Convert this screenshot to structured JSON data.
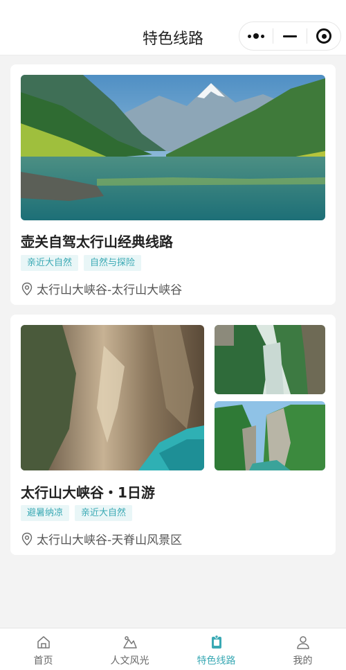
{
  "nav": {
    "title": "特色线路"
  },
  "routes": [
    {
      "title": "壶关自驾太行山经典线路",
      "tags": [
        "亲近大自然",
        "自然与探险"
      ],
      "location": "太行山大峡谷-太行山大峡谷"
    },
    {
      "title": "太行山大峡谷・1日游",
      "tags": [
        "避暑纳凉",
        "亲近大自然"
      ],
      "location": "太行山大峡谷-天脊山风景区"
    }
  ],
  "tabbar": {
    "items": [
      {
        "label": "首页",
        "icon": "home-icon"
      },
      {
        "label": "人文风光",
        "icon": "scenery-icon"
      },
      {
        "label": "特色线路",
        "icon": "route-icon"
      },
      {
        "label": "我的",
        "icon": "user-icon"
      }
    ],
    "active_index": 2
  },
  "colors": {
    "accent": "#3aa9b4",
    "tag_bg": "#e9f6f7"
  }
}
